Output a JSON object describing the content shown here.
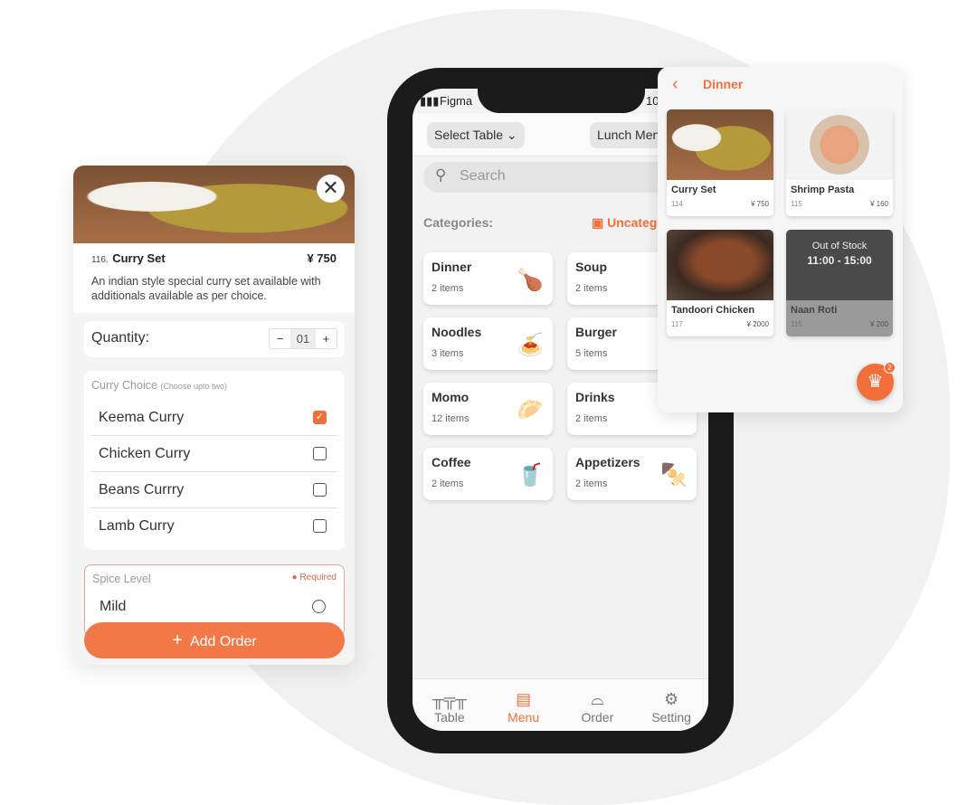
{
  "item_card": {
    "number": "116.",
    "name": "Curry Set",
    "price": "¥ 750",
    "description": "An indian style special curry set available with additionals available as per choice.",
    "quantity_label": "Quantity:",
    "quantity": "01",
    "curry_choice_label": "Curry Choice",
    "curry_choice_hint": "(Choose upto two)",
    "curry_options": [
      {
        "label": "Keema Curry",
        "checked": true
      },
      {
        "label": "Chicken Curry",
        "checked": false
      },
      {
        "label": "Beans Currry",
        "checked": false
      },
      {
        "label": "Lamb Curry",
        "checked": false
      }
    ],
    "spice_label": "Spice Level",
    "required_label": "Required",
    "spice_options": [
      {
        "label": "Mild"
      }
    ],
    "add_order_label": "Add Order"
  },
  "phone": {
    "carrier": "Figma",
    "time": "10",
    "select_table": "Select Table",
    "menu_select": "Lunch Menu",
    "search_placeholder": "Search",
    "categories_label": "Categories:",
    "uncategorized": "Uncategorized",
    "categories": [
      {
        "name": "Dinner",
        "count": "2 items",
        "icon": "🍗"
      },
      {
        "name": "Soup",
        "count": "2 items",
        "icon": ""
      },
      {
        "name": "Noodles",
        "count": "3 items",
        "icon": "🍝"
      },
      {
        "name": "Burger",
        "count": "5 items",
        "icon": ""
      },
      {
        "name": "Momo",
        "count": "12 items",
        "icon": "🥟"
      },
      {
        "name": "Drinks",
        "count": "2 items",
        "icon": ""
      },
      {
        "name": "Coffee",
        "count": "2 items",
        "icon": "🥤"
      },
      {
        "name": "Appetizers",
        "count": "2 items",
        "icon": "🍢"
      }
    ],
    "tabs": [
      {
        "label": "Table",
        "icon": "table-icon",
        "active": false
      },
      {
        "label": "Menu",
        "icon": "menu-book-icon",
        "active": true
      },
      {
        "label": "Order",
        "icon": "bell-icon",
        "active": false
      },
      {
        "label": "Setting",
        "icon": "gear-icon",
        "active": false
      }
    ]
  },
  "dinner_panel": {
    "title": "Dinner",
    "dishes": [
      {
        "name": "Curry Set",
        "code": "114",
        "price": "¥ 750"
      },
      {
        "name": "Shrimp Pasta",
        "code": "115",
        "price": "¥ 160"
      },
      {
        "name": "Tandoori Chicken",
        "code": "117",
        "price": "¥ 2000"
      },
      {
        "name": "Naan Roti",
        "code": "115",
        "price": "¥ 200",
        "out_of_stock": "Out of Stock",
        "hours": "11:00 - 15:00"
      }
    ],
    "cart_count": "2"
  },
  "colors": {
    "accent": "#f26f3c"
  }
}
